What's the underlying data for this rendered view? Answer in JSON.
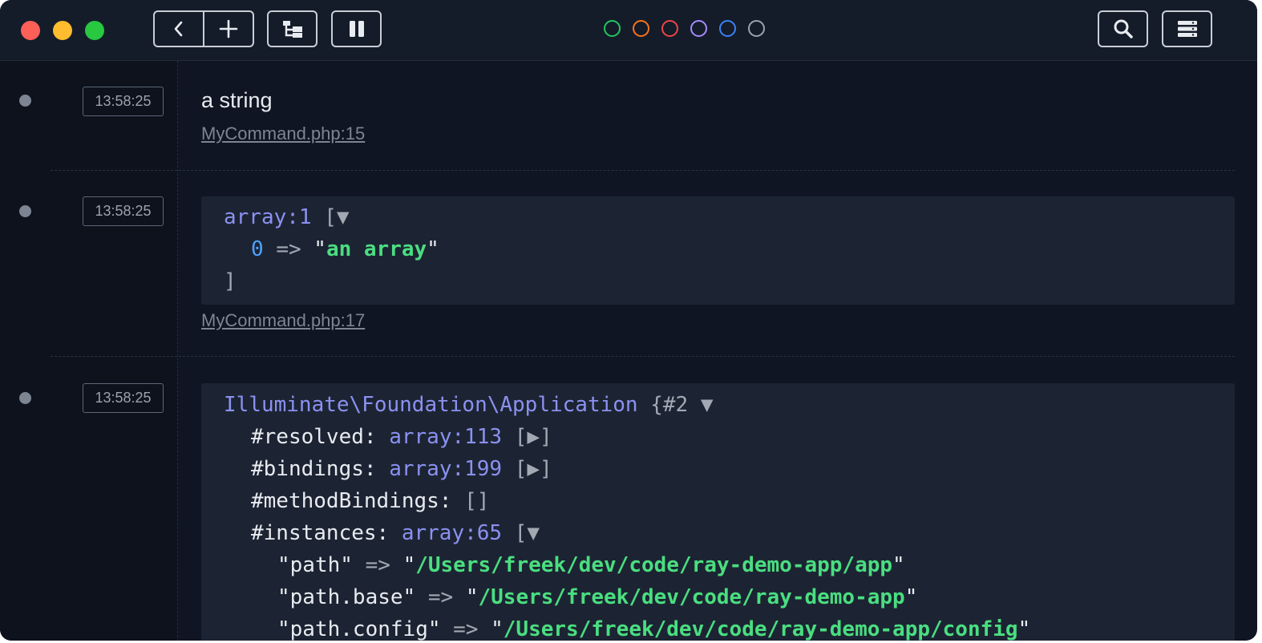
{
  "toolbar": {
    "back_icon": "chevron-left-icon",
    "new_icon": "plus-icon",
    "tree_icon": "tree-icon",
    "pause_icon": "pause-icon",
    "search_icon": "search-icon",
    "menu_icon": "server-menu-icon",
    "color_filters": [
      {
        "name": "green",
        "color": "#22c55e"
      },
      {
        "name": "orange",
        "color": "#f97316"
      },
      {
        "name": "red",
        "color": "#ef4444"
      },
      {
        "name": "purple",
        "color": "#a78bfa"
      },
      {
        "name": "blue",
        "color": "#3b82f6"
      },
      {
        "name": "gray",
        "color": "#9ca3af"
      }
    ]
  },
  "entries": [
    {
      "time": "13:58:25",
      "text": "a string",
      "source": "MyCommand.php:15"
    },
    {
      "time": "13:58:25",
      "source": "MyCommand.php:17",
      "code": {
        "type": "array:1",
        "open": "[▼",
        "index": "0",
        "arrow": "=>",
        "value": "an array",
        "close": "]"
      }
    },
    {
      "time": "13:58:25",
      "code": {
        "class": "Illuminate\\Foundation\\Application",
        "object_ref": "{#2",
        "expand": "▼",
        "props": [
          {
            "name": "#resolved:",
            "type": "array:113",
            "bracket": "[▶]"
          },
          {
            "name": "#bindings:",
            "type": "array:199",
            "bracket": "[▶]"
          },
          {
            "name": "#methodBindings:",
            "type": "",
            "bracket": "[]"
          },
          {
            "name": "#instances:",
            "type": "array:65",
            "bracket": "[▼"
          }
        ],
        "instances": [
          {
            "key": "path",
            "arrow": "=>",
            "value": "/Users/freek/dev/code/ray-demo-app/app"
          },
          {
            "key": "path.base",
            "arrow": "=>",
            "value": "/Users/freek/dev/code/ray-demo-app"
          },
          {
            "key": "path.config",
            "arrow": "=>",
            "value": "/Users/freek/dev/code/ray-demo-app/config"
          }
        ]
      }
    }
  ]
}
